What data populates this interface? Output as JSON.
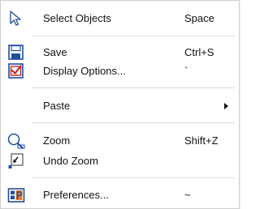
{
  "menu": {
    "items": [
      {
        "label": "Select Objects",
        "shortcut": "Space",
        "icon": "select-arrow-icon"
      },
      {
        "label": "Save",
        "shortcut": "Ctrl+S",
        "icon": "save-icon"
      },
      {
        "label": "Display Options...",
        "shortcut": "`",
        "icon": "display-options-icon"
      },
      {
        "label": "Paste",
        "shortcut": "",
        "icon": "",
        "submenu": true
      },
      {
        "label": "Zoom",
        "shortcut": "Shift+Z",
        "icon": "zoom-icon"
      },
      {
        "label": "Undo Zoom",
        "shortcut": "",
        "icon": "undo-zoom-icon"
      },
      {
        "label": "Preferences...",
        "shortcut": "~",
        "icon": "preferences-icon"
      }
    ]
  },
  "colors": {
    "icon_blue": "#1f4e9c",
    "checkbox_red": "#c8262b",
    "preferences_orange": "#f07d2e"
  }
}
